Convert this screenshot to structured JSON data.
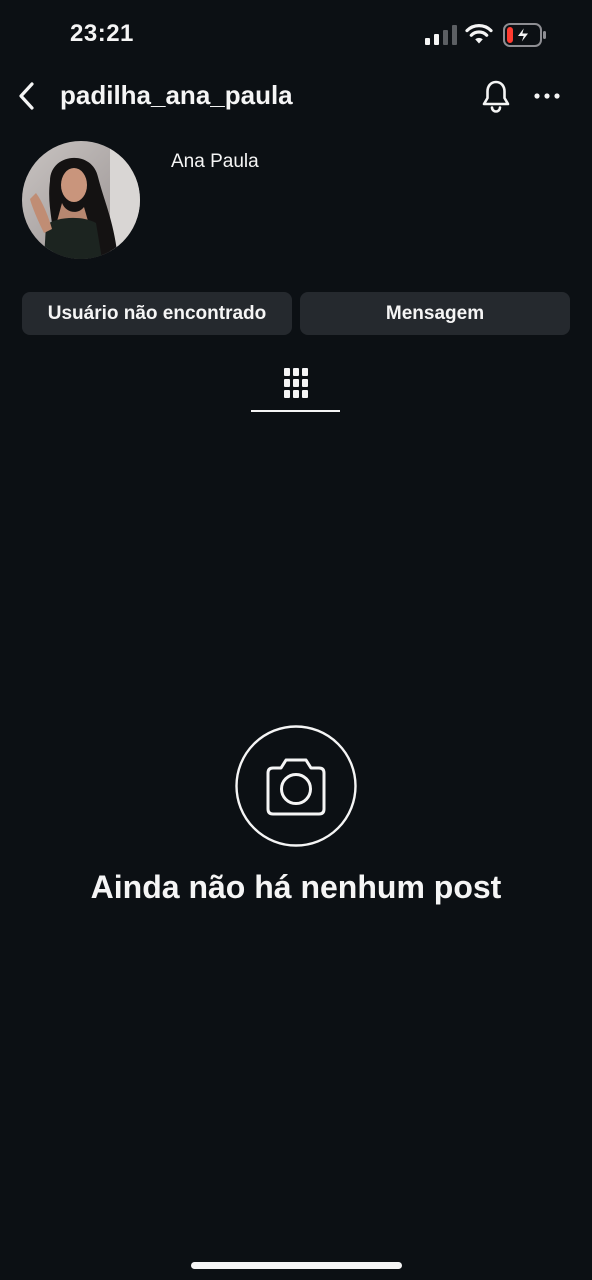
{
  "status_bar": {
    "time": "23:21",
    "signal_icon": "cellular-signal-icon",
    "wifi_icon": "wifi-icon",
    "battery_icon": "battery-charging-icon",
    "battery_color": "#ff3b30"
  },
  "header": {
    "back_icon": "chevron-left-icon",
    "username": "padilha_ana_paula",
    "notifications_icon": "bell-icon",
    "more_icon": "ellipsis-icon"
  },
  "profile": {
    "display_name": "Ana Paula",
    "avatar_icon": "profile-photo"
  },
  "actions": {
    "user_not_found_label": "Usuário não encontrado",
    "message_label": "Mensagem"
  },
  "tabs": {
    "posts_icon": "grid-icon"
  },
  "empty_state": {
    "icon": "camera-icon",
    "title": "Ainda não há nenhum post"
  },
  "colors": {
    "background": "#0c1014",
    "button_background": "#25292e",
    "text": "#f5f5f5"
  }
}
